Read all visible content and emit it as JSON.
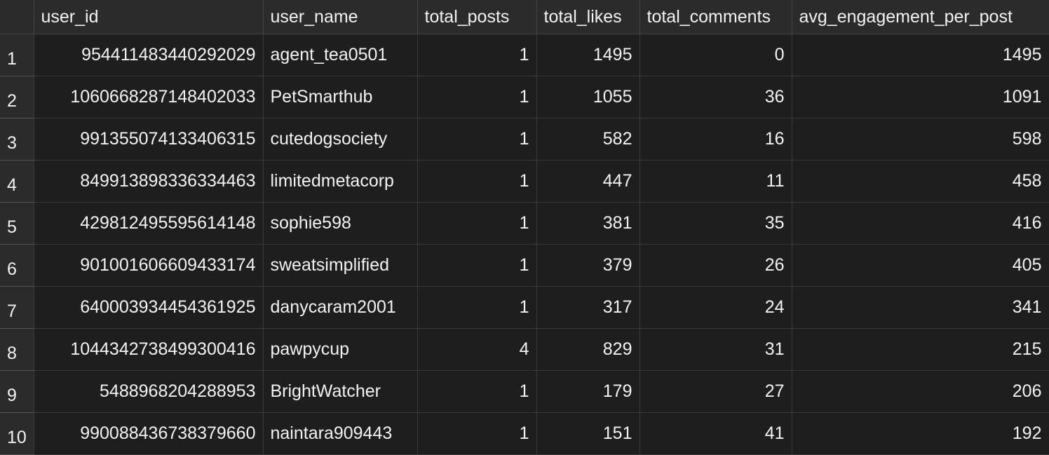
{
  "columns": [
    "user_id",
    "user_name",
    "total_posts",
    "total_likes",
    "total_comments",
    "avg_engagement_per_post"
  ],
  "rows": [
    {
      "index": "1",
      "user_id": "954411483440292029",
      "user_name": "agent_tea0501",
      "total_posts": "1",
      "total_likes": "1495",
      "total_comments": "0",
      "avg_engagement_per_post": "1495"
    },
    {
      "index": "2",
      "user_id": "1060668287148402033",
      "user_name": "PetSmarthub",
      "total_posts": "1",
      "total_likes": "1055",
      "total_comments": "36",
      "avg_engagement_per_post": "1091"
    },
    {
      "index": "3",
      "user_id": "991355074133406315",
      "user_name": "cutedogsociety",
      "total_posts": "1",
      "total_likes": "582",
      "total_comments": "16",
      "avg_engagement_per_post": "598"
    },
    {
      "index": "4",
      "user_id": "849913898336334463",
      "user_name": "limitedmetacorp",
      "total_posts": "1",
      "total_likes": "447",
      "total_comments": "11",
      "avg_engagement_per_post": "458"
    },
    {
      "index": "5",
      "user_id": "429812495595614148",
      "user_name": "sophie598",
      "total_posts": "1",
      "total_likes": "381",
      "total_comments": "35",
      "avg_engagement_per_post": "416"
    },
    {
      "index": "6",
      "user_id": "901001606609433174",
      "user_name": "sweatsimplified",
      "total_posts": "1",
      "total_likes": "379",
      "total_comments": "26",
      "avg_engagement_per_post": "405"
    },
    {
      "index": "7",
      "user_id": "640003934454361925",
      "user_name": "danycaram2001",
      "total_posts": "1",
      "total_likes": "317",
      "total_comments": "24",
      "avg_engagement_per_post": "341"
    },
    {
      "index": "8",
      "user_id": "1044342738499300416",
      "user_name": "pawpycup",
      "total_posts": "4",
      "total_likes": "829",
      "total_comments": "31",
      "avg_engagement_per_post": "215"
    },
    {
      "index": "9",
      "user_id": "5488968204288953",
      "user_name": "BrightWatcher",
      "total_posts": "1",
      "total_likes": "179",
      "total_comments": "27",
      "avg_engagement_per_post": "206"
    },
    {
      "index": "10",
      "user_id": "990088436738379660",
      "user_name": "naintara909443",
      "total_posts": "1",
      "total_likes": "151",
      "total_comments": "41",
      "avg_engagement_per_post": "192"
    }
  ]
}
